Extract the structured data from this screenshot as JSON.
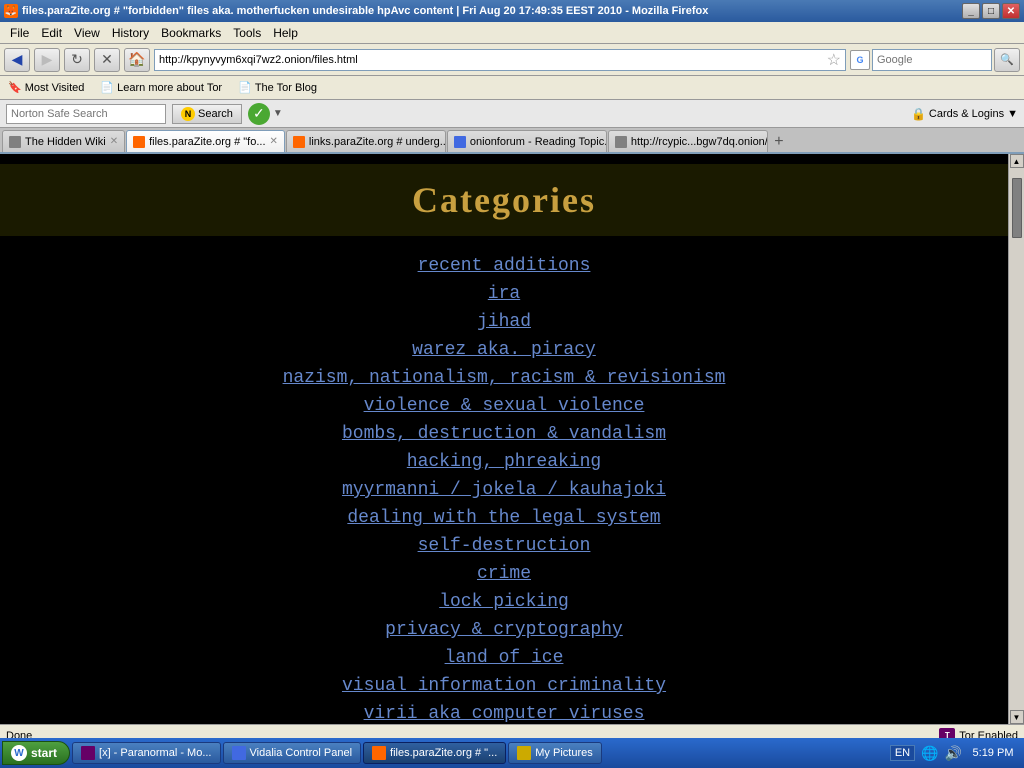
{
  "window": {
    "title": "files.paraZite.org # \"forbidden\" files aka. motherfucken undesirable hpAvc content  |  Fri Aug 20 17:49:35 EEST 2010 - Mozilla Firefox",
    "favicon": "🦊"
  },
  "menu": {
    "items": [
      "File",
      "Edit",
      "View",
      "History",
      "Bookmarks",
      "Tools",
      "Help"
    ]
  },
  "nav": {
    "url": "http://kpynyvym6xqi7wz2.onion/files.html",
    "back_disabled": false,
    "forward_disabled": true
  },
  "bookmarks": {
    "items": [
      {
        "label": "Most Visited"
      },
      {
        "label": "Learn more about Tor"
      },
      {
        "label": "The Tor Blog"
      }
    ]
  },
  "norton": {
    "search_placeholder": "Norton Safe Search",
    "search_btn": "Search",
    "cards_logins": "Cards & Logins"
  },
  "tabs": [
    {
      "label": "The Hidden Wiki",
      "active": false,
      "favicon_color": "gray"
    },
    {
      "label": "files.paraZite.org # \"fo...",
      "active": true,
      "favicon_color": "orange"
    },
    {
      "label": "links.paraZite.org # underg...",
      "active": false,
      "favicon_color": "orange"
    },
    {
      "label": "onionforum - Reading Topic...",
      "active": false,
      "favicon_color": "blue"
    },
    {
      "label": "http://rcypic...bgw7dq.onion/",
      "active": false,
      "favicon_color": "gray"
    }
  ],
  "content": {
    "header": "Categories",
    "categories": [
      "recent additions",
      "ira",
      "jihad",
      "warez aka. piracy",
      "nazism, nationalism, racism & revisionism",
      "violence & sexual violence",
      "bombs, destruction & vandalism",
      "hacking, phreaking",
      "myyrmanni / jokela / kauhajoki",
      "dealing with the legal system",
      "self-destruction",
      "crime",
      "lock picking",
      "privacy & cryptography",
      "land of ice",
      "visual information criminality",
      "virii aka computer viruses"
    ]
  },
  "status": {
    "left": "Done",
    "tor_enabled": "Tor Enabled"
  },
  "taskbar": {
    "start": "start",
    "time": "5:19 PM",
    "lang": "EN",
    "buttons": [
      {
        "label": "[x] - Paranormal - Mo...",
        "favicon": "purple"
      },
      {
        "label": "Vidalia Control Panel",
        "favicon": "blue"
      },
      {
        "label": "files.paraZite.org # \"...",
        "favicon": "orange",
        "active": true
      },
      {
        "label": "My Pictures",
        "favicon": "yellow"
      }
    ]
  }
}
